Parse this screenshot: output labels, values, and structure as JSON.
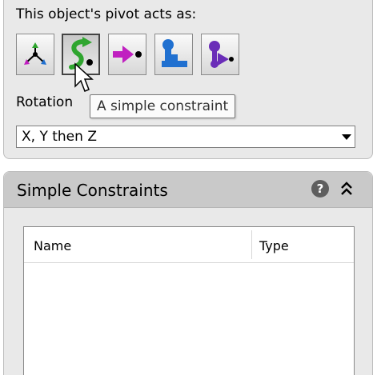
{
  "pivot_section": {
    "title": "This object's pivot acts as:",
    "buttons": [
      {
        "name": "pivot-point-icon"
      },
      {
        "name": "simple-constraint-icon",
        "selected": true
      },
      {
        "name": "direction-icon"
      },
      {
        "name": "hinge-icon"
      },
      {
        "name": "ball-joint-icon"
      }
    ],
    "tooltip": "A simple constraint",
    "rotation_label": "Rotation",
    "rotation_value": "X, Y then Z"
  },
  "constraints_panel": {
    "title": "Simple Constraints",
    "help_icon": "?",
    "columns": [
      "Name",
      "Type"
    ],
    "rows": []
  },
  "colors": {
    "panel_bg": "#e9e9e9",
    "header_bg": "#c9c9c9",
    "accent_green": "#2fa52f",
    "accent_magenta": "#c020c0",
    "accent_blue": "#2070d0",
    "accent_purple": "#6a2db8"
  }
}
